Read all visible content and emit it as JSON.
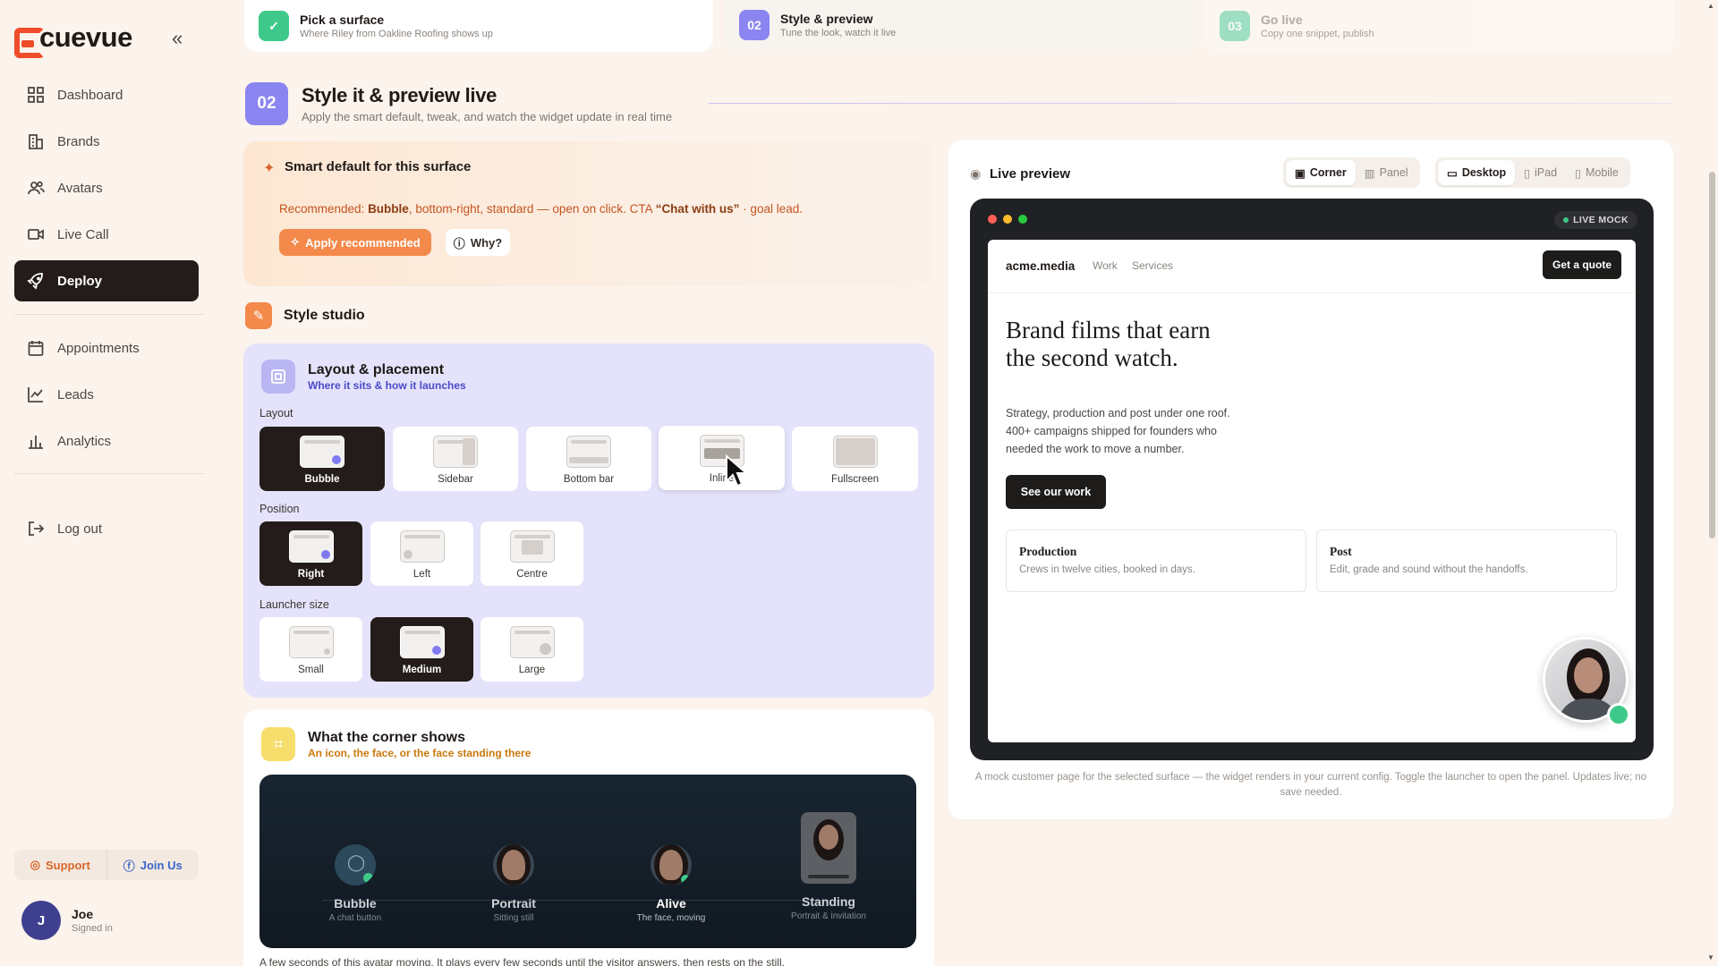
{
  "app": {
    "name": "cuevue"
  },
  "sidebar": {
    "items": [
      {
        "label": "Dashboard",
        "icon": "grid-icon"
      },
      {
        "label": "Brands",
        "icon": "building-icon"
      },
      {
        "label": "Avatars",
        "icon": "users-icon"
      },
      {
        "label": "Live Call",
        "icon": "video-icon"
      },
      {
        "label": "Deploy",
        "icon": "rocket-icon",
        "active": true
      },
      {
        "label": "Appointments",
        "icon": "calendar-icon"
      },
      {
        "label": "Leads",
        "icon": "trend-icon"
      },
      {
        "label": "Analytics",
        "icon": "bar-chart-icon"
      },
      {
        "label": "Log out",
        "icon": "logout-icon"
      }
    ],
    "support_label": "Support",
    "join_label": "Join Us",
    "user": {
      "initial": "J",
      "name": "Joe",
      "status": "Signed in"
    }
  },
  "steps": [
    {
      "num": "✓",
      "title": "Pick a surface",
      "sub": "Where Riley from Oakline Roofing shows up",
      "color": "#3ec98a"
    },
    {
      "num": "02",
      "title": "Style & preview",
      "sub": "Tune the look, watch it live",
      "color": "#8a85f0"
    },
    {
      "num": "03",
      "title": "Go live",
      "sub": "Copy one snippet, publish",
      "color": "#7fd7b5"
    }
  ],
  "header": {
    "num": "02",
    "title": "Style it & preview live",
    "sub": "Apply the smart default, tweak, and watch the widget update in real time"
  },
  "smart": {
    "title": "Smart default for this surface",
    "rec_prefix": "Recommended: ",
    "rec_layout": "Bubble",
    "rec_mid": ", bottom-right, standard — open on click. CTA ",
    "rec_cta": "“Chat with us”",
    "rec_suffix": " · goal lead.",
    "apply_label": "Apply recommended",
    "why_label": "Why?"
  },
  "studio": {
    "title": "Style studio"
  },
  "layout_card": {
    "title": "Layout & placement",
    "sub": "Where it sits & how it launches",
    "layout_label": "Layout",
    "layouts": [
      "Bubble",
      "Sidebar",
      "Bottom bar",
      "Inline",
      "Fullscreen"
    ],
    "selected_layout": "Bubble",
    "position_label": "Position",
    "positions": [
      "Right",
      "Left",
      "Centre"
    ],
    "selected_position": "Right",
    "size_label": "Launcher size",
    "sizes": [
      "Small",
      "Medium",
      "Large"
    ],
    "selected_size": "Medium"
  },
  "corner": {
    "title": "What the corner shows",
    "sub": "An icon, the face, or the face standing there",
    "options": [
      {
        "title": "Bubble",
        "sub": "A chat button"
      },
      {
        "title": "Portrait",
        "sub": "Sitting still"
      },
      {
        "title": "Alive",
        "sub": "The face, moving"
      },
      {
        "title": "Standing",
        "sub": "Portrait & invitation"
      }
    ],
    "selected": "Alive",
    "foot": "A few seconds of this avatar moving. It plays every few seconds until the visitor answers, then rests on the still."
  },
  "preview": {
    "title": "Live preview",
    "mode_tabs": [
      "Corner",
      "Panel"
    ],
    "device_tabs": [
      "Desktop",
      "iPad",
      "Mobile"
    ],
    "active_mode": "Corner",
    "active_device": "Desktop",
    "badge": "LIVE MOCK",
    "site": {
      "brand": "acme.media",
      "nav": [
        "Work",
        "Services"
      ],
      "cta": "Get a quote",
      "hero": "Brand films that earn the second watch.",
      "para": "Strategy, production and post under one roof. 400+ campaigns shipped for founders who needed the work to move a number.",
      "button": "See our work",
      "features": [
        {
          "title": "Production",
          "sub": "Crews in twelve cities, booked in days."
        },
        {
          "title": "Post",
          "sub": "Edit, grade and sound without the handoffs."
        }
      ]
    },
    "caption": "A mock customer page for the selected surface — the widget renders in your current config. Toggle the launcher to open the panel. Updates live; no save needed."
  },
  "colors": {
    "accent": "#ef4c2a",
    "violet": "#8a85f0",
    "dark": "#231c1a",
    "orange": "#f3894a"
  }
}
